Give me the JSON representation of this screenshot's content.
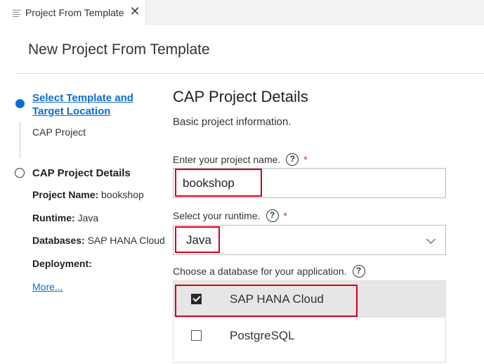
{
  "tab": {
    "title": "Project From Template",
    "icon": "list-icon",
    "close_glyph": "✕"
  },
  "page": {
    "title": "New Project From Template"
  },
  "steps": [
    {
      "label": "Select Template and Target Location",
      "sub": "CAP Project",
      "state": "active"
    },
    {
      "label": "CAP Project Details",
      "state": "inactive"
    }
  ],
  "summary": {
    "project_name_label": "Project Name:",
    "project_name_value": "bookshop",
    "runtime_label": "Runtime:",
    "runtime_value": "Java",
    "databases_label": "Databases:",
    "databases_value": "SAP HANA Cloud",
    "deployment_label": "Deployment:",
    "more_link": "More..."
  },
  "form": {
    "title": "CAP Project Details",
    "subtitle": "Basic project information.",
    "project_name": {
      "label": "Enter your project name.",
      "help": "?",
      "required": "*",
      "value": "bookshop"
    },
    "runtime": {
      "label": "Select your runtime.",
      "help": "?",
      "required": "*",
      "value": "Java"
    },
    "database": {
      "label": "Choose a database for your application.",
      "help": "?",
      "options": [
        {
          "label": "SAP HANA Cloud",
          "checked": true
        },
        {
          "label": "PostgreSQL",
          "checked": false
        }
      ]
    }
  },
  "colors": {
    "accent": "#0a6ed1",
    "highlight_box": "#d0021b",
    "selected_row": "#e6e6e6",
    "required": "#c0392b"
  }
}
